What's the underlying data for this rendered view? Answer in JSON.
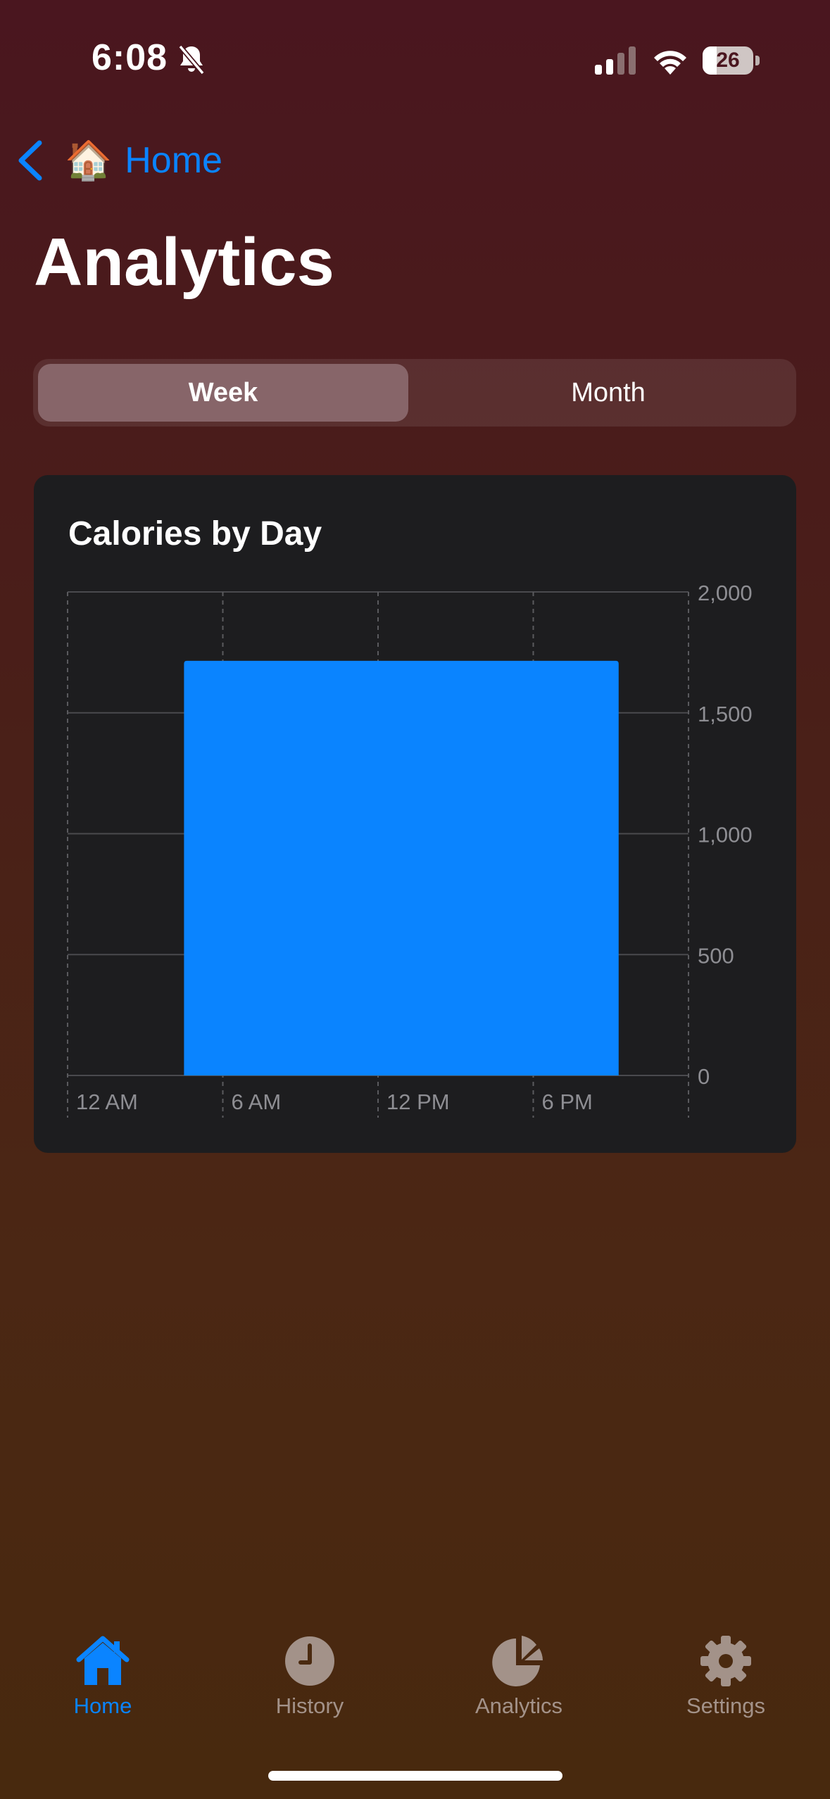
{
  "status_bar": {
    "time": "6:08",
    "battery_level": "26",
    "icons": [
      "bell-slash-icon",
      "cellular-signal-icon",
      "wifi-icon",
      "battery-icon"
    ]
  },
  "nav": {
    "back_icon": "chevron-left-icon",
    "back_emoji": "🏠",
    "back_label": "Home"
  },
  "page": {
    "title": "Analytics"
  },
  "segmented": {
    "options": [
      "Week",
      "Month"
    ],
    "selected": "Week"
  },
  "chart_card": {
    "title": "Calories by Day"
  },
  "chart_data": {
    "type": "bar",
    "title": "Calories by Day",
    "x_ticks": [
      "12 AM",
      "6 AM",
      "12 PM",
      "6 PM"
    ],
    "y_ticks": [
      0,
      500,
      1000,
      1500,
      2000
    ],
    "y_tick_labels": [
      "0",
      "500",
      "1,000",
      "1,500",
      "2,000"
    ],
    "ylim": [
      0,
      2000
    ],
    "y_axis_position": "right",
    "bars": [
      {
        "start_hour": 4.5,
        "end_hour": 21.3,
        "value": 1715
      }
    ],
    "bar_color": "#0a84ff",
    "grid": true
  },
  "tab_bar": {
    "tabs": [
      {
        "label": "Home",
        "icon": "house-icon",
        "active": true
      },
      {
        "label": "History",
        "icon": "clock-icon",
        "active": false
      },
      {
        "label": "Analytics",
        "icon": "pie-chart-icon",
        "active": false
      },
      {
        "label": "Settings",
        "icon": "gear-icon",
        "active": false
      }
    ],
    "active_color": "#0a84ff",
    "inactive_color": "#a39289"
  }
}
